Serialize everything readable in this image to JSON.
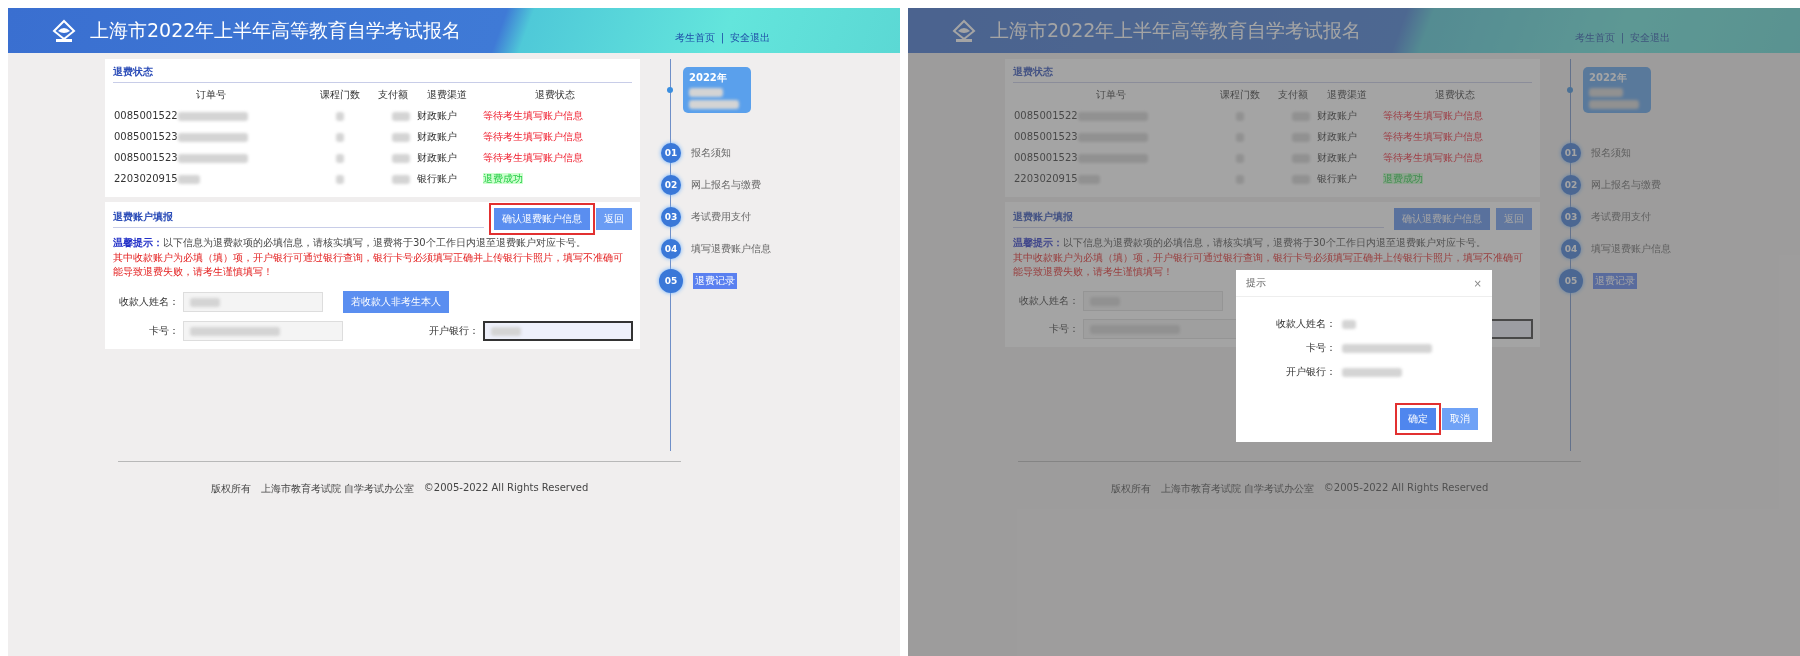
{
  "screens": [
    {
      "dimmed": false,
      "header": {
        "title": "上海市2022年上半年高等教育自学考试报名",
        "links": [
          "考生首页",
          "安全退出"
        ],
        "separator": "|"
      },
      "refund_status": {
        "title": "退费状态",
        "columns": [
          "订单号",
          "课程门数",
          "支付额",
          "退费渠道",
          "退费状态"
        ],
        "rows": [
          {
            "order_no": "0085001522",
            "channel": "财政账户",
            "status": "等待考生填写账户信息",
            "kind": "pending"
          },
          {
            "order_no": "0085001523",
            "channel": "财政账户",
            "status": "等待考生填写账户信息",
            "kind": "pending"
          },
          {
            "order_no": "0085001523",
            "channel": "财政账户",
            "status": "等待考生填写账户信息",
            "kind": "pending"
          },
          {
            "order_no": "2203020915",
            "channel": "银行账户",
            "status": "退费成功",
            "kind": "done"
          }
        ]
      },
      "account_form": {
        "title": "退费账户填报",
        "buttons": [
          {
            "label": "确认退费账户信息",
            "kind": "confirm",
            "highlighted": true
          },
          {
            "label": "返回",
            "kind": "back",
            "highlighted": false
          }
        ],
        "notice_label": "温馨提示：",
        "notice": "以下信息为退费款项的必填信息，请核实填写，退费将于30个工作日内退至退费账户对应卡号。",
        "warning": "其中收款账户为必填（填）项，开户银行可通过银行查询，银行卡号必须填写正确并上传银行卡照片，填写不准确可能导致退费失败，请考生谨慎填写！",
        "fields": [
          {
            "label": "收款人姓名：",
            "kind": "name"
          },
          {
            "label": "卡号：",
            "kind": "card"
          },
          {
            "label": "开户银行：",
            "kind": "bank"
          }
        ],
        "alt_button": "若收款人非考生本人"
      },
      "timeline": {
        "bubble": "2022年",
        "steps": [
          {
            "number": "01",
            "label": "报名须知",
            "selected": false
          },
          {
            "number": "02",
            "label": "网上报名与缴费",
            "selected": false
          },
          {
            "number": "03",
            "label": "考试费用支付",
            "selected": false
          },
          {
            "number": "04",
            "label": "填写退费账户信息",
            "selected": false
          },
          {
            "number": "05",
            "label": "退费记录",
            "selected": true
          }
        ]
      },
      "footer": {
        "parts": [
          "版权所有",
          "上海市教育考试院 自学考试办公室",
          "©2005-2022 All Rights Reserved"
        ]
      }
    },
    {
      "dimmed": true,
      "header": {
        "title": "上海市2022年上半年高等教育自学考试报名",
        "links": [
          "考生首页",
          "安全退出"
        ],
        "separator": "|"
      },
      "refund_status": {
        "title": "退费状态",
        "columns": [
          "订单号",
          "课程门数",
          "支付额",
          "退费渠道",
          "退费状态"
        ],
        "rows": [
          {
            "order_no": "0085001522",
            "channel": "财政账户",
            "status": "等待考生填写账户信息",
            "kind": "pending"
          },
          {
            "order_no": "0085001523",
            "channel": "财政账户",
            "status": "等待考生填写账户信息",
            "kind": "pending"
          },
          {
            "order_no": "0085001523",
            "channel": "财政账户",
            "status": "等待考生填写账户信息",
            "kind": "pending"
          },
          {
            "order_no": "2203020915",
            "channel": "银行账户",
            "status": "退费成功",
            "kind": "done"
          }
        ]
      },
      "account_form": {
        "title": "退费账户填报",
        "buttons": [
          {
            "label": "确认退费账户信息",
            "kind": "confirm",
            "highlighted": false
          },
          {
            "label": "返回",
            "kind": "back",
            "highlighted": false
          }
        ],
        "notice_label": "温馨提示：",
        "notice": "以下信息为退费款项的必填信息，请核实填写，退费将于30个工作日内退至退费账户对应卡号。",
        "warning": "其中收款账户为必填（填）项，开户银行可通过银行查询，银行卡号必须填写正确并上传银行卡照片，填写不准确可能导致退费失败，请考生谨慎填写！",
        "fields": [
          {
            "label": "收款人姓名：",
            "kind": "name"
          },
          {
            "label": "卡号：",
            "kind": "card"
          },
          {
            "kind": "bank"
          }
        ]
      },
      "timeline": {
        "bubble": "2022年",
        "steps": [
          {
            "number": "01",
            "label": "报名须知",
            "selected": false
          },
          {
            "number": "02",
            "label": "网上报名与缴费",
            "selected": false
          },
          {
            "number": "03",
            "label": "考试费用支付",
            "selected": false
          },
          {
            "number": "04",
            "label": "填写退费账户信息",
            "selected": false
          },
          {
            "number": "05",
            "label": "退费记录",
            "selected": true
          }
        ]
      },
      "footer": {
        "parts": [
          "版权所有",
          "上海市教育考试院 自学考试办公室",
          "©2005-2022 All Rights Reserved"
        ]
      },
      "dialog": {
        "title": "提示",
        "close": "×",
        "fields": [
          "收款人姓名：",
          "卡号：",
          "开户银行："
        ],
        "buttons": [
          {
            "label": "确定",
            "kind": "ok",
            "highlighted": true
          },
          {
            "label": "取消",
            "kind": "cancel",
            "highlighted": false
          }
        ]
      }
    }
  ]
}
